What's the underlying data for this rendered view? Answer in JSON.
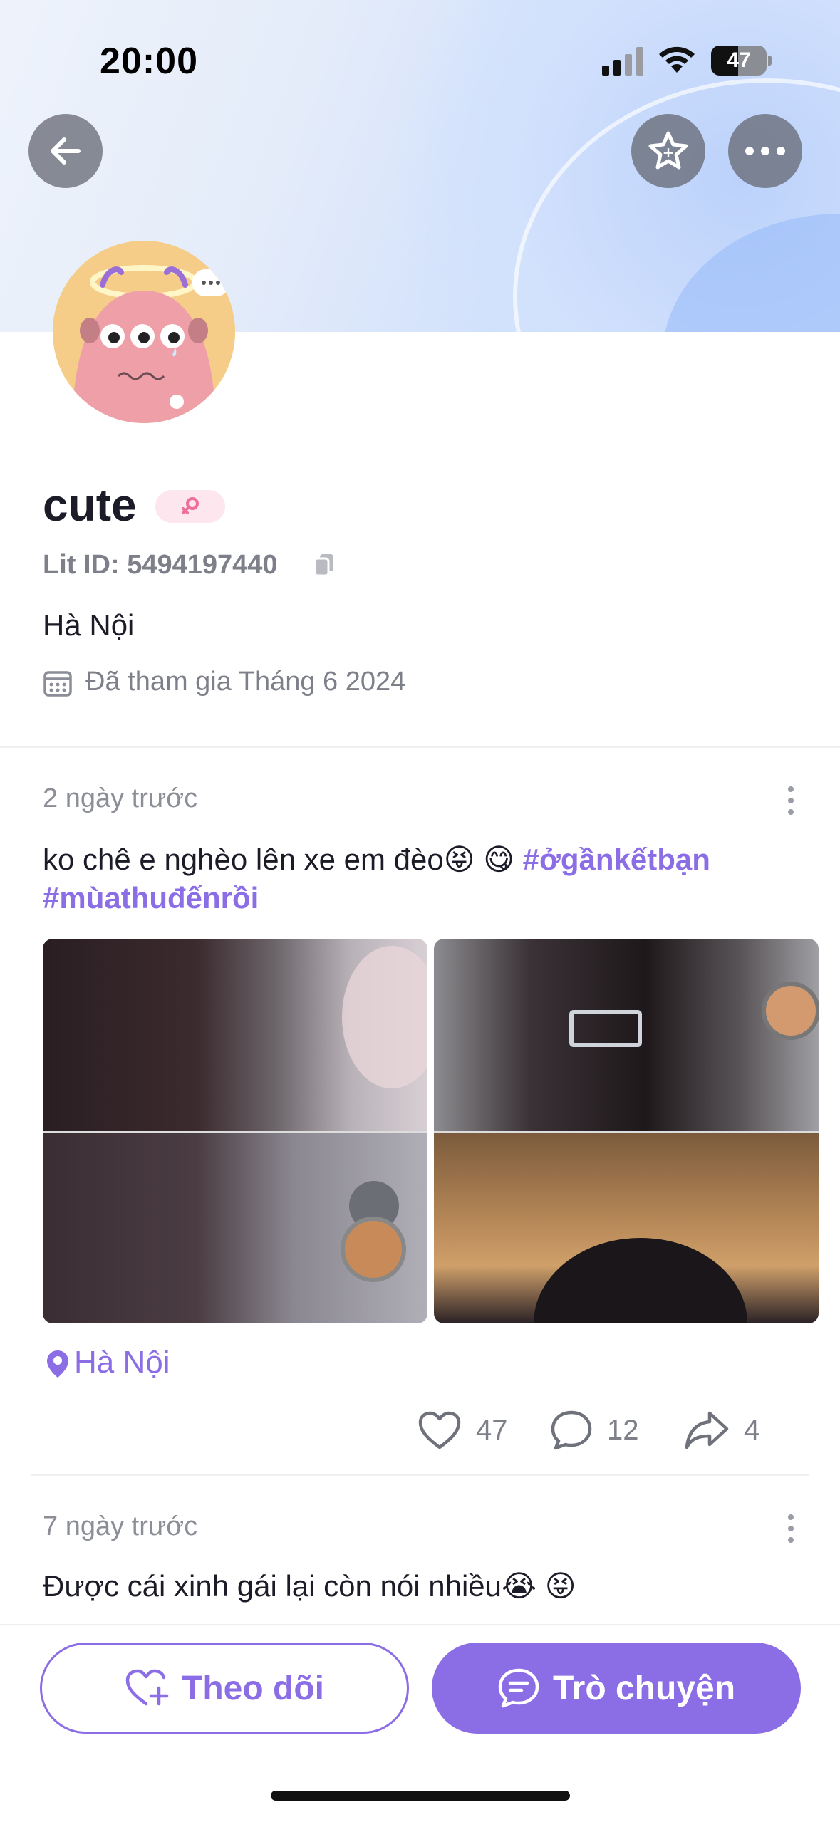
{
  "status_bar": {
    "time": "20:00",
    "battery": "47",
    "battery_level_pct": 47
  },
  "header": {
    "back_icon": "arrow-left-icon",
    "favorite_icon": "star-add-icon",
    "more_icon": "more-horizontal-icon"
  },
  "profile": {
    "name": "cute",
    "gender_icon": "female-icon",
    "lit_id": "Lit ID: 5494197440",
    "city": "Hà Nội",
    "joined": "Đã tham gia Tháng 6 2024"
  },
  "posts": [
    {
      "time": "2 ngày trước",
      "text": "ko chê e nghèo lên xe em đèo😝 😋",
      "hashtags": [
        "#ởgầnkếtbạn",
        "#mùathuđếnrồi"
      ],
      "location": "Hà Nội",
      "likes": "47",
      "comments": "12",
      "shares": "4"
    },
    {
      "time": "7 ngày trước",
      "text": "Được cái xinh gái lại còn nói nhiều😭 😝"
    }
  ],
  "actions": {
    "follow_label": "Theo dõi",
    "chat_label": "Trò chuyện"
  },
  "colors": {
    "accent": "#8b6de6",
    "muted": "#7d8089",
    "text": "#1c1c28"
  }
}
